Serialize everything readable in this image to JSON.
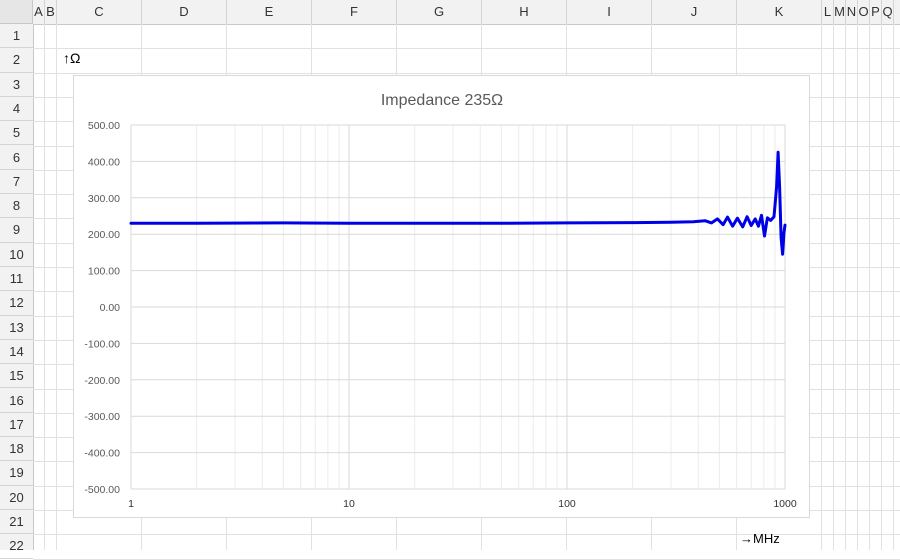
{
  "spreadsheet": {
    "columns": [
      "A",
      "B",
      "C",
      "D",
      "E",
      "F",
      "G",
      "H",
      "I",
      "J",
      "K",
      "L",
      "M",
      "N",
      "O",
      "P",
      "Q"
    ],
    "rows": [
      "1",
      "2",
      "3",
      "4",
      "5",
      "6",
      "7",
      "8",
      "9",
      "10",
      "11",
      "12",
      "13",
      "14",
      "15",
      "16",
      "17",
      "18",
      "19",
      "20",
      "21",
      "22"
    ],
    "cell_y_label": "↑Ω",
    "cell_x_label": "→MHz"
  },
  "colors": {
    "series": "#0000e6",
    "grid": "#d9d9d9",
    "gridMinor": "#ececec",
    "axisText": "#595959",
    "title": "#595959"
  },
  "chart_data": {
    "type": "line",
    "title": "Impedance 235Ω",
    "xlabel": "",
    "ylabel": "",
    "xscale": "log",
    "xlim": [
      1,
      1000
    ],
    "ylim": [
      -500,
      500
    ],
    "x_ticks": [
      "1",
      "10",
      "100",
      "1000"
    ],
    "y_ticks": [
      "500.00",
      "400.00",
      "300.00",
      "200.00",
      "100.00",
      "0.00",
      "-100.00",
      "-200.00",
      "-300.00",
      "-400.00",
      "-500.00"
    ],
    "grid": true,
    "series": [
      {
        "color": "#0000e6",
        "x": [
          1,
          2,
          5,
          10,
          20,
          50,
          100,
          200,
          300,
          380,
          430,
          460,
          490,
          520,
          545,
          575,
          605,
          640,
          670,
          700,
          730,
          755,
          780,
          805,
          830,
          860,
          890,
          915,
          930,
          945,
          960,
          975,
          990,
          1000
        ],
        "y": [
          230,
          230,
          231,
          230,
          230,
          230,
          231,
          232,
          233,
          234,
          237,
          231,
          242,
          226,
          247,
          222,
          244,
          220,
          248,
          224,
          242,
          222,
          252,
          195,
          245,
          238,
          248,
          330,
          425,
          330,
          190,
          145,
          205,
          225
        ]
      }
    ]
  }
}
